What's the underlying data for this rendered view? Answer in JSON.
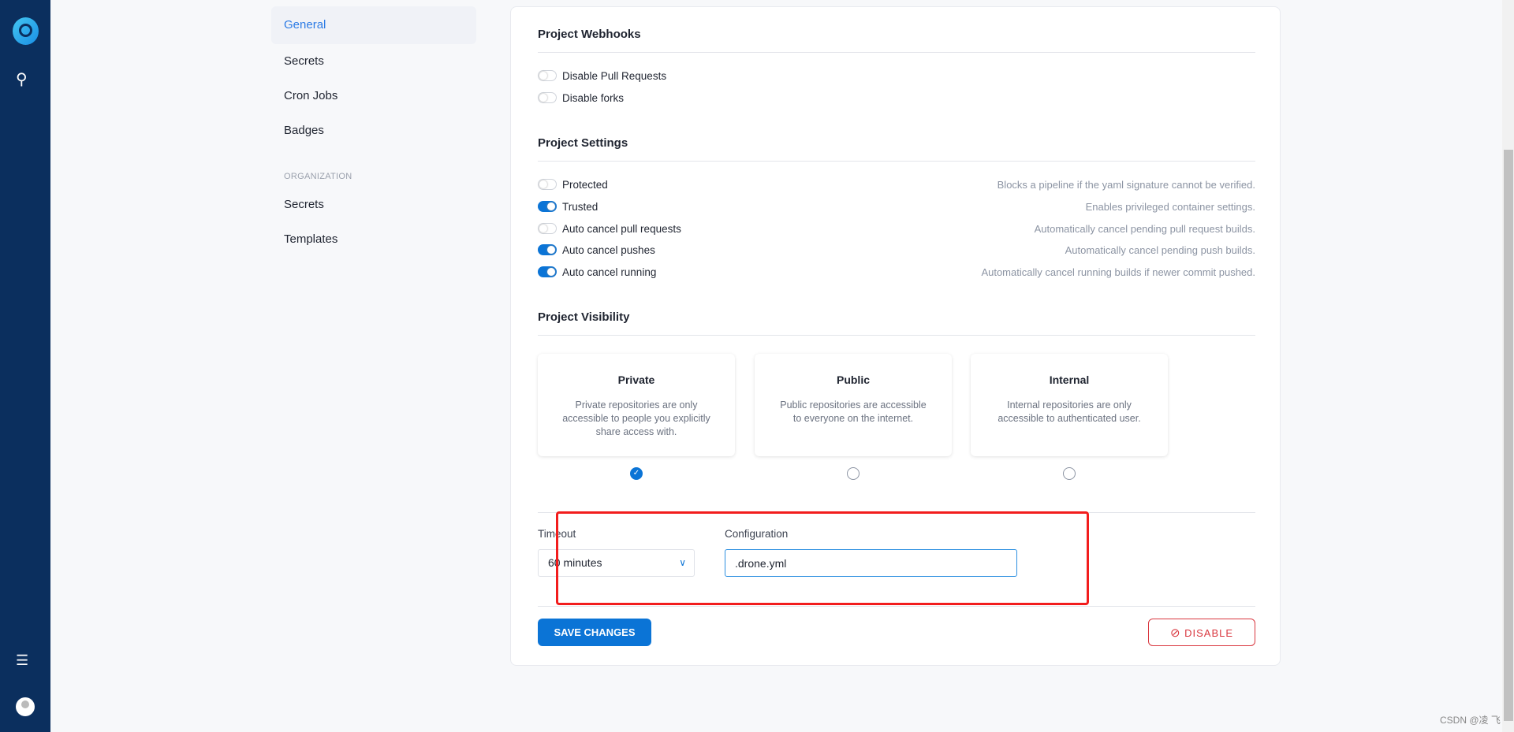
{
  "sidebar": {
    "icons": [
      "drone-logo-icon",
      "search-icon",
      "sliders-icon",
      "user-avatar-icon"
    ]
  },
  "nav": {
    "repo_items": [
      "General",
      "Secrets",
      "Cron Jobs",
      "Badges"
    ],
    "active": "General",
    "org_header": "ORGANIZATION",
    "org_items": [
      "Secrets",
      "Templates"
    ]
  },
  "webhooks": {
    "title": "Project Webhooks",
    "items": [
      {
        "label": "Disable Pull Requests",
        "on": false
      },
      {
        "label": "Disable forks",
        "on": false
      }
    ]
  },
  "settings": {
    "title": "Project Settings",
    "items": [
      {
        "label": "Protected",
        "desc": "Blocks a pipeline if the yaml signature cannot be verified.",
        "on": false
      },
      {
        "label": "Trusted",
        "desc": "Enables privileged container settings.",
        "on": true
      },
      {
        "label": "Auto cancel pull requests",
        "desc": "Automatically cancel pending pull request builds.",
        "on": false
      },
      {
        "label": "Auto cancel pushes",
        "desc": "Automatically cancel pending push builds.",
        "on": true
      },
      {
        "label": "Auto cancel running",
        "desc": "Automatically cancel running builds if newer commit pushed.",
        "on": true
      }
    ]
  },
  "visibility": {
    "title": "Project Visibility",
    "selected": "Private",
    "options": [
      {
        "title": "Private",
        "desc": "Private repositories are only accessible to people you explicitly share access with."
      },
      {
        "title": "Public",
        "desc": "Public repositories are accessible to everyone on the internet."
      },
      {
        "title": "Internal",
        "desc": "Internal repositories are only accessible to authenticated user."
      }
    ]
  },
  "timeout": {
    "label": "Timeout",
    "value": "60 minutes"
  },
  "configuration": {
    "label": "Configuration",
    "value": ".drone.yml"
  },
  "actions": {
    "save": "SAVE CHANGES",
    "disable": "DISABLE"
  },
  "annotation_color": "#f21d1d",
  "watermark": "CSDN @凌 飞"
}
